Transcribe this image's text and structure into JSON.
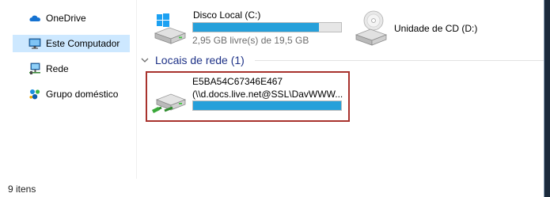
{
  "sidebar": {
    "items": [
      {
        "label": "OneDrive",
        "icon": "cloud-icon",
        "selected": false
      },
      {
        "label": "Este Computador",
        "icon": "computer-icon",
        "selected": true
      },
      {
        "label": "Rede",
        "icon": "network-icon",
        "selected": false
      },
      {
        "label": "Grupo doméstico",
        "icon": "homegroup-icon",
        "selected": false
      }
    ]
  },
  "devices": {
    "local_disk": {
      "name": "Disco Local (C:)",
      "free_text": "2,95 GB livre(s) de 19,5 GB",
      "used_fraction": 0.85,
      "icon": "windows-drive-icon"
    },
    "cd_drive": {
      "name": "Unidade de CD (D:)",
      "icon": "cd-drive-icon"
    }
  },
  "network_locations": {
    "header": "Locais de rede (1)",
    "items": [
      {
        "name": "E5BA54C67346E467",
        "path": "(\\\\d.docs.live.net@SSL\\DavWWW...",
        "used_fraction": 1.0,
        "icon": "network-drive-icon"
      }
    ]
  },
  "status_bar": {
    "item_count": "9 itens"
  },
  "colors": {
    "selection": "#cde8ff",
    "bar_fill": "#26a0da",
    "group_header": "#1e3287",
    "highlight_box": "#a8322d"
  }
}
